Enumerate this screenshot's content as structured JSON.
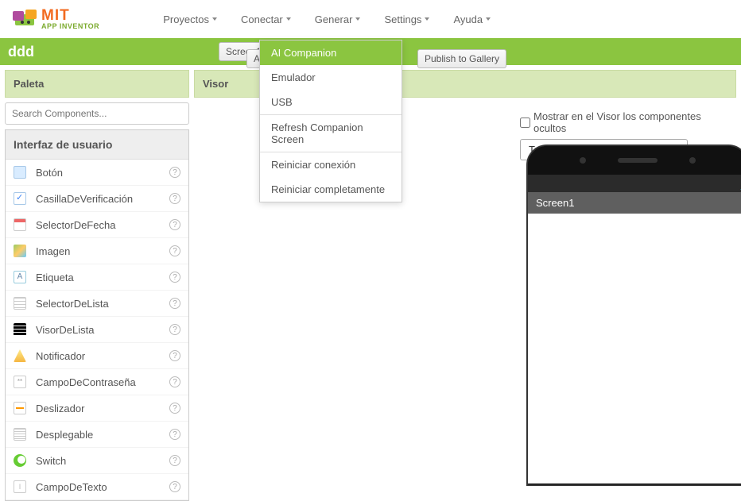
{
  "brand": {
    "mit": "MIT",
    "sub": "APP INVENTOR"
  },
  "menu": {
    "proyectos": "Proyectos",
    "conectar": "Conectar",
    "generar": "Generar",
    "settings": "Settings",
    "ayuda": "Ayuda"
  },
  "project": {
    "name": "ddd"
  },
  "toolbar": {
    "screen": "Screen1",
    "add_fragment": "Añ",
    "publish": "Publish to Gallery"
  },
  "dropdown": {
    "ai_companion": "AI Companion",
    "emulador": "Emulador",
    "usb": "USB",
    "refresh": "Refresh Companion Screen",
    "reiniciar_conexion": "Reiniciar conexión",
    "reiniciar_completo": "Reiniciar completamente"
  },
  "palette": {
    "title": "Paleta",
    "search_placeholder": "Search Components...",
    "category": "Interfaz de usuario",
    "items": {
      "boton": "Botón",
      "casilla": "CasillaDeVerificación",
      "fecha": "SelectorDeFecha",
      "imagen": "Imagen",
      "etiqueta": "Etiqueta",
      "sel_lista": "SelectorDeLista",
      "visor_lista": "VisorDeLista",
      "notificador": "Notificador",
      "contrasena": "CampoDeContraseña",
      "deslizador": "Deslizador",
      "desplegable": "Desplegable",
      "switch": "Switch",
      "texto": "CampoDeTexto"
    }
  },
  "visor": {
    "title": "Visor",
    "show_hidden": "Mostrar en el Visor los componentes ocultos",
    "phone_size": "Tamaño del teléfono (505,320)",
    "screen_name": "Screen1"
  },
  "glyphs": {
    "help": "?",
    "label_A": "A",
    "pass": "**",
    "text_I": "I"
  }
}
